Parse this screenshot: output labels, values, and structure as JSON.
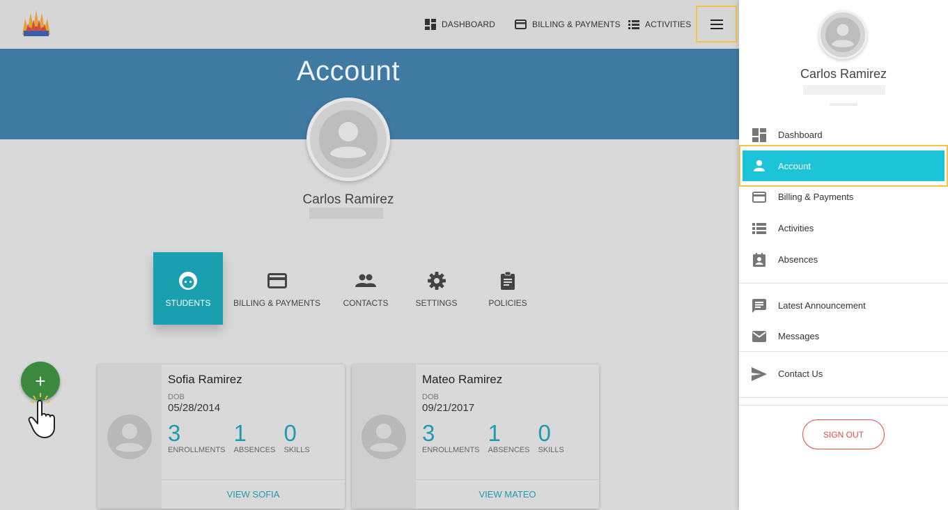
{
  "topnav": {
    "dashboard": "DASHBOARD",
    "billing": "BILLING & PAYMENTS",
    "activities": "ACTIVITIES"
  },
  "page": {
    "title": "Account",
    "user_name": "Carlos Ramirez"
  },
  "tabs": [
    {
      "label": "STUDENTS",
      "icon": "student-face-icon",
      "active": true
    },
    {
      "label": "BILLING & PAYMENTS",
      "icon": "credit-card-icon",
      "active": false
    },
    {
      "label": "CONTACTS",
      "icon": "people-icon",
      "active": false
    },
    {
      "label": "SETTINGS",
      "icon": "gear-icon",
      "active": false
    },
    {
      "label": "POLICIES",
      "icon": "clipboard-icon",
      "active": false
    }
  ],
  "fab": {
    "label": "+"
  },
  "students": [
    {
      "name": "Sofia Ramirez",
      "dob_label": "DOB",
      "dob": "05/28/2014",
      "enrollments": "3",
      "absences": "1",
      "skills": "0",
      "enrollments_label": "ENROLLMENTS",
      "absences_label": "ABSENCES",
      "skills_label": "SKILLS",
      "view_label": "VIEW SOFIA"
    },
    {
      "name": "Mateo Ramirez",
      "dob_label": "DOB",
      "dob": "09/21/2017",
      "enrollments": "3",
      "absences": "1",
      "skills": "0",
      "enrollments_label": "ENROLLMENTS",
      "absences_label": "ABSENCES",
      "skills_label": "SKILLS",
      "view_label": "VIEW MATEO"
    }
  ],
  "drawer": {
    "user_name": "Carlos Ramirez",
    "items": [
      {
        "label": "Dashboard",
        "icon": "dashboard-icon"
      },
      {
        "label": "Account",
        "icon": "person-icon",
        "active": true
      },
      {
        "label": "Billing & Payments",
        "icon": "credit-card-icon"
      },
      {
        "label": "Activities",
        "icon": "list-icon"
      },
      {
        "label": "Absences",
        "icon": "calendar-person-icon"
      },
      {
        "label": "Latest Announcement",
        "icon": "chat-icon"
      },
      {
        "label": "Messages",
        "icon": "mail-icon"
      },
      {
        "label": "Contact Us",
        "icon": "send-icon"
      }
    ],
    "sign_out": "SIGN OUT"
  },
  "colors": {
    "banner": "#3f7aa3",
    "accent_teal": "#1a9fb0",
    "drawer_active": "#1dc4d8",
    "fab_green": "#3b8a3f",
    "highlight_frame": "#f3c343",
    "sign_out_red": "#e24a4a"
  }
}
